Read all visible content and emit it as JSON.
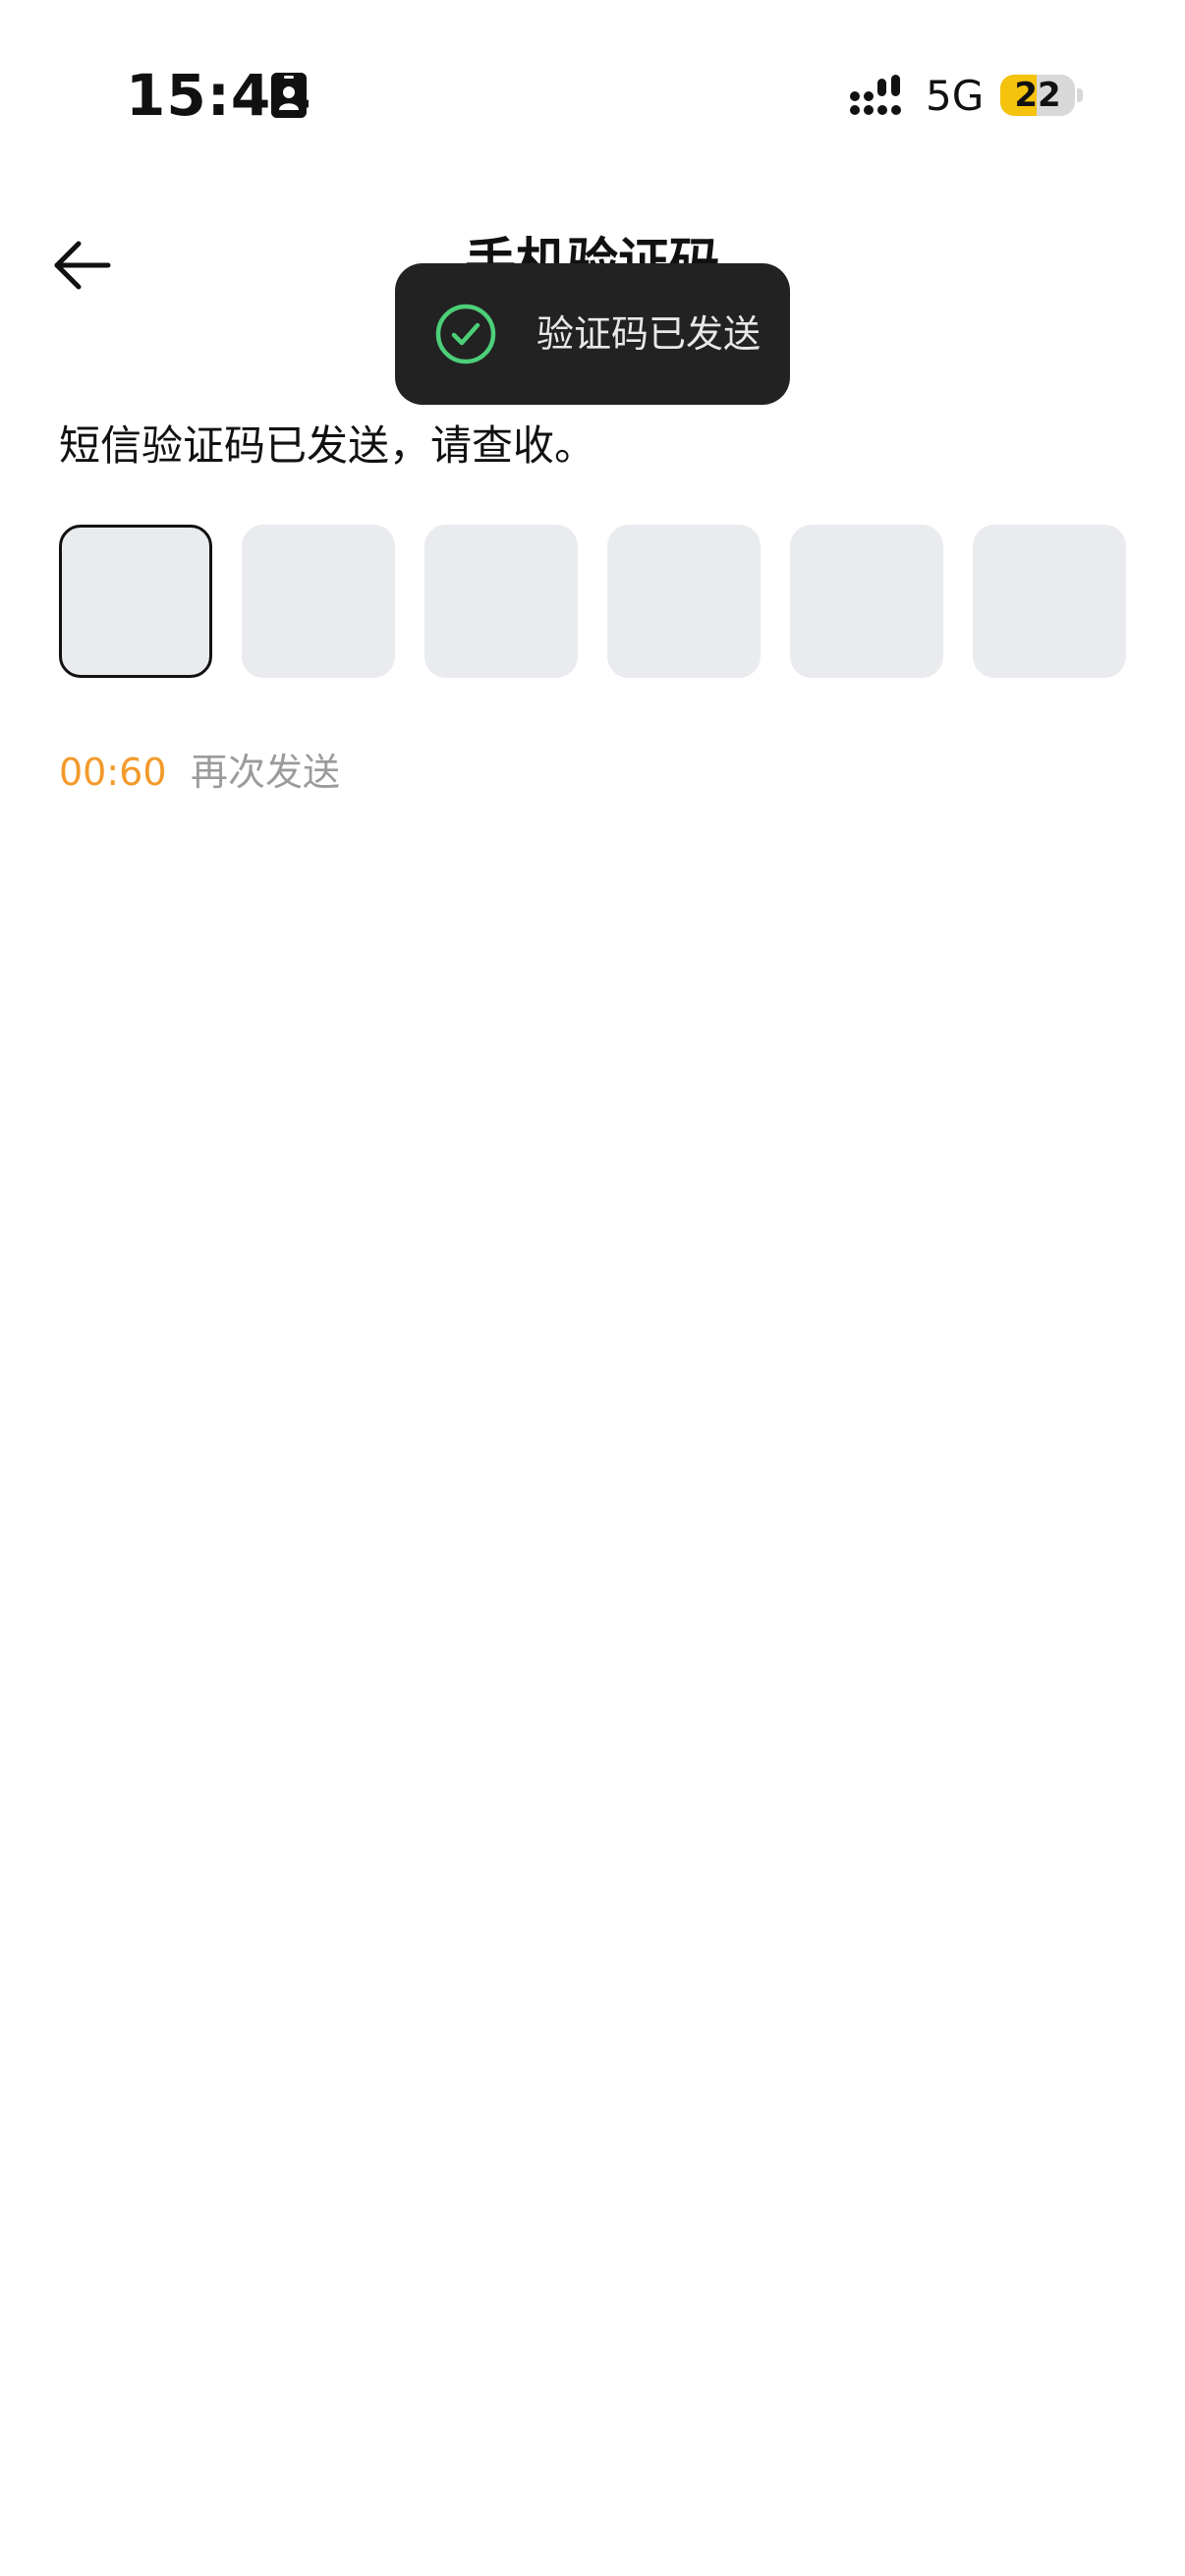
{
  "status_bar": {
    "time": "15:44",
    "network": "5G",
    "battery_level": "22",
    "battery_fraction": 0.22,
    "id_icon": "id-card-icon",
    "signal_icon": "signal-bars-icon"
  },
  "header": {
    "title": "手机验证码",
    "back_icon": "arrow-left-icon"
  },
  "toast": {
    "text": "验证码已发送",
    "icon": "check-circle-icon",
    "icon_color": "#4ccf78"
  },
  "main": {
    "instruction": "短信验证码已发送，请查收。",
    "code_boxes": [
      "",
      "",
      "",
      "",
      "",
      ""
    ],
    "countdown": "00:60",
    "resend_label": "再次发送"
  },
  "colors": {
    "countdown": "#f39a2b",
    "resend": "#9b9b9b",
    "code_box_bg": "#e9ebef",
    "toast_bg": "#222222",
    "battery_fill": "#f5c20c"
  }
}
